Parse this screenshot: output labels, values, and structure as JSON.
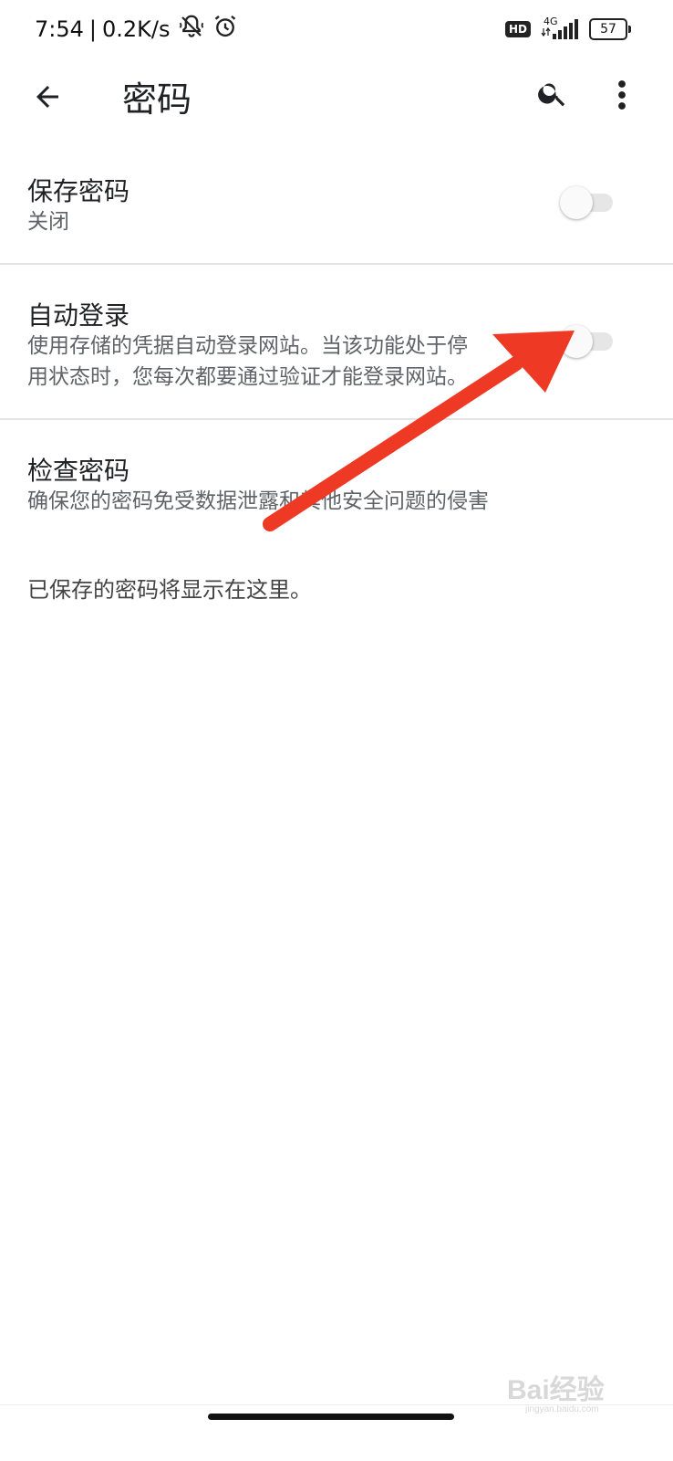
{
  "status_bar": {
    "time": "7:54",
    "separator": "|",
    "net_speed": "0.2K/s",
    "hd_label": "HD",
    "network_type": "4G",
    "battery_level": "57",
    "icons": [
      "mute-notification-icon",
      "alarm-icon",
      "signal-icon",
      "battery-icon"
    ]
  },
  "app_bar": {
    "title": "密码",
    "icons": [
      "back-arrow-icon",
      "search-icon",
      "more-vert-icon"
    ]
  },
  "settings": [
    {
      "title": "保存密码",
      "subtitle": "关闭",
      "toggle_on": false
    },
    {
      "title": "自动登录",
      "subtitle_lines": [
        "使用存储的凭据自动登录网站。当该功能处于停",
        "用状态时，您每次都要通过验证才能登录网站。"
      ],
      "toggle_on": false
    },
    {
      "title": "检查密码",
      "subtitle": "确保您的密码免受数据泄露和其他安全问题的侵害"
    }
  ],
  "empty_note": "已保存的密码将显示在这里。",
  "annotation": {
    "color": "#ee3a24"
  },
  "watermark": {
    "text": "Bai经验",
    "subtext": "jingyan.baidu.com"
  }
}
